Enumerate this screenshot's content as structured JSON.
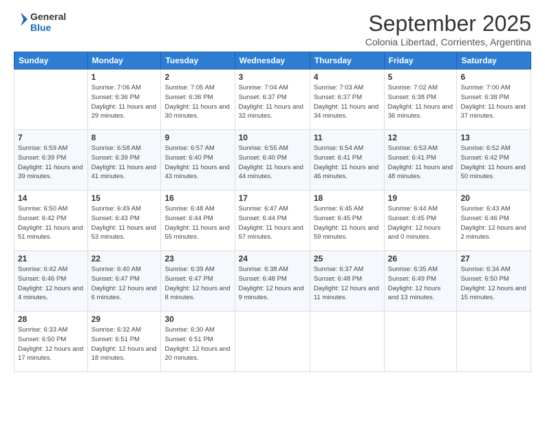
{
  "logo": {
    "line1": "General",
    "line2": "Blue"
  },
  "title": "September 2025",
  "subtitle": "Colonia Libertad, Corrientes, Argentina",
  "weekdays": [
    "Sunday",
    "Monday",
    "Tuesday",
    "Wednesday",
    "Thursday",
    "Friday",
    "Saturday"
  ],
  "weeks": [
    [
      {
        "day": "",
        "sunrise": "",
        "sunset": "",
        "daylight": ""
      },
      {
        "day": "1",
        "sunrise": "Sunrise: 7:06 AM",
        "sunset": "Sunset: 6:36 PM",
        "daylight": "Daylight: 11 hours and 29 minutes."
      },
      {
        "day": "2",
        "sunrise": "Sunrise: 7:05 AM",
        "sunset": "Sunset: 6:36 PM",
        "daylight": "Daylight: 11 hours and 30 minutes."
      },
      {
        "day": "3",
        "sunrise": "Sunrise: 7:04 AM",
        "sunset": "Sunset: 6:37 PM",
        "daylight": "Daylight: 11 hours and 32 minutes."
      },
      {
        "day": "4",
        "sunrise": "Sunrise: 7:03 AM",
        "sunset": "Sunset: 6:37 PM",
        "daylight": "Daylight: 11 hours and 34 minutes."
      },
      {
        "day": "5",
        "sunrise": "Sunrise: 7:02 AM",
        "sunset": "Sunset: 6:38 PM",
        "daylight": "Daylight: 11 hours and 36 minutes."
      },
      {
        "day": "6",
        "sunrise": "Sunrise: 7:00 AM",
        "sunset": "Sunset: 6:38 PM",
        "daylight": "Daylight: 11 hours and 37 minutes."
      }
    ],
    [
      {
        "day": "7",
        "sunrise": "Sunrise: 6:59 AM",
        "sunset": "Sunset: 6:39 PM",
        "daylight": "Daylight: 11 hours and 39 minutes."
      },
      {
        "day": "8",
        "sunrise": "Sunrise: 6:58 AM",
        "sunset": "Sunset: 6:39 PM",
        "daylight": "Daylight: 11 hours and 41 minutes."
      },
      {
        "day": "9",
        "sunrise": "Sunrise: 6:57 AM",
        "sunset": "Sunset: 6:40 PM",
        "daylight": "Daylight: 11 hours and 43 minutes."
      },
      {
        "day": "10",
        "sunrise": "Sunrise: 6:55 AM",
        "sunset": "Sunset: 6:40 PM",
        "daylight": "Daylight: 11 hours and 44 minutes."
      },
      {
        "day": "11",
        "sunrise": "Sunrise: 6:54 AM",
        "sunset": "Sunset: 6:41 PM",
        "daylight": "Daylight: 11 hours and 46 minutes."
      },
      {
        "day": "12",
        "sunrise": "Sunrise: 6:53 AM",
        "sunset": "Sunset: 6:41 PM",
        "daylight": "Daylight: 11 hours and 48 minutes."
      },
      {
        "day": "13",
        "sunrise": "Sunrise: 6:52 AM",
        "sunset": "Sunset: 6:42 PM",
        "daylight": "Daylight: 11 hours and 50 minutes."
      }
    ],
    [
      {
        "day": "14",
        "sunrise": "Sunrise: 6:50 AM",
        "sunset": "Sunset: 6:42 PM",
        "daylight": "Daylight: 11 hours and 51 minutes."
      },
      {
        "day": "15",
        "sunrise": "Sunrise: 6:49 AM",
        "sunset": "Sunset: 6:43 PM",
        "daylight": "Daylight: 11 hours and 53 minutes."
      },
      {
        "day": "16",
        "sunrise": "Sunrise: 6:48 AM",
        "sunset": "Sunset: 6:44 PM",
        "daylight": "Daylight: 11 hours and 55 minutes."
      },
      {
        "day": "17",
        "sunrise": "Sunrise: 6:47 AM",
        "sunset": "Sunset: 6:44 PM",
        "daylight": "Daylight: 11 hours and 57 minutes."
      },
      {
        "day": "18",
        "sunrise": "Sunrise: 6:45 AM",
        "sunset": "Sunset: 6:45 PM",
        "daylight": "Daylight: 11 hours and 59 minutes."
      },
      {
        "day": "19",
        "sunrise": "Sunrise: 6:44 AM",
        "sunset": "Sunset: 6:45 PM",
        "daylight": "Daylight: 12 hours and 0 minutes."
      },
      {
        "day": "20",
        "sunrise": "Sunrise: 6:43 AM",
        "sunset": "Sunset: 6:46 PM",
        "daylight": "Daylight: 12 hours and 2 minutes."
      }
    ],
    [
      {
        "day": "21",
        "sunrise": "Sunrise: 6:42 AM",
        "sunset": "Sunset: 6:46 PM",
        "daylight": "Daylight: 12 hours and 4 minutes."
      },
      {
        "day": "22",
        "sunrise": "Sunrise: 6:40 AM",
        "sunset": "Sunset: 6:47 PM",
        "daylight": "Daylight: 12 hours and 6 minutes."
      },
      {
        "day": "23",
        "sunrise": "Sunrise: 6:39 AM",
        "sunset": "Sunset: 6:47 PM",
        "daylight": "Daylight: 12 hours and 8 minutes."
      },
      {
        "day": "24",
        "sunrise": "Sunrise: 6:38 AM",
        "sunset": "Sunset: 6:48 PM",
        "daylight": "Daylight: 12 hours and 9 minutes."
      },
      {
        "day": "25",
        "sunrise": "Sunrise: 6:37 AM",
        "sunset": "Sunset: 6:48 PM",
        "daylight": "Daylight: 12 hours and 11 minutes."
      },
      {
        "day": "26",
        "sunrise": "Sunrise: 6:35 AM",
        "sunset": "Sunset: 6:49 PM",
        "daylight": "Daylight: 12 hours and 13 minutes."
      },
      {
        "day": "27",
        "sunrise": "Sunrise: 6:34 AM",
        "sunset": "Sunset: 6:50 PM",
        "daylight": "Daylight: 12 hours and 15 minutes."
      }
    ],
    [
      {
        "day": "28",
        "sunrise": "Sunrise: 6:33 AM",
        "sunset": "Sunset: 6:50 PM",
        "daylight": "Daylight: 12 hours and 17 minutes."
      },
      {
        "day": "29",
        "sunrise": "Sunrise: 6:32 AM",
        "sunset": "Sunset: 6:51 PM",
        "daylight": "Daylight: 12 hours and 18 minutes."
      },
      {
        "day": "30",
        "sunrise": "Sunrise: 6:30 AM",
        "sunset": "Sunset: 6:51 PM",
        "daylight": "Daylight: 12 hours and 20 minutes."
      },
      {
        "day": "",
        "sunrise": "",
        "sunset": "",
        "daylight": ""
      },
      {
        "day": "",
        "sunrise": "",
        "sunset": "",
        "daylight": ""
      },
      {
        "day": "",
        "sunrise": "",
        "sunset": "",
        "daylight": ""
      },
      {
        "day": "",
        "sunrise": "",
        "sunset": "",
        "daylight": ""
      }
    ]
  ]
}
